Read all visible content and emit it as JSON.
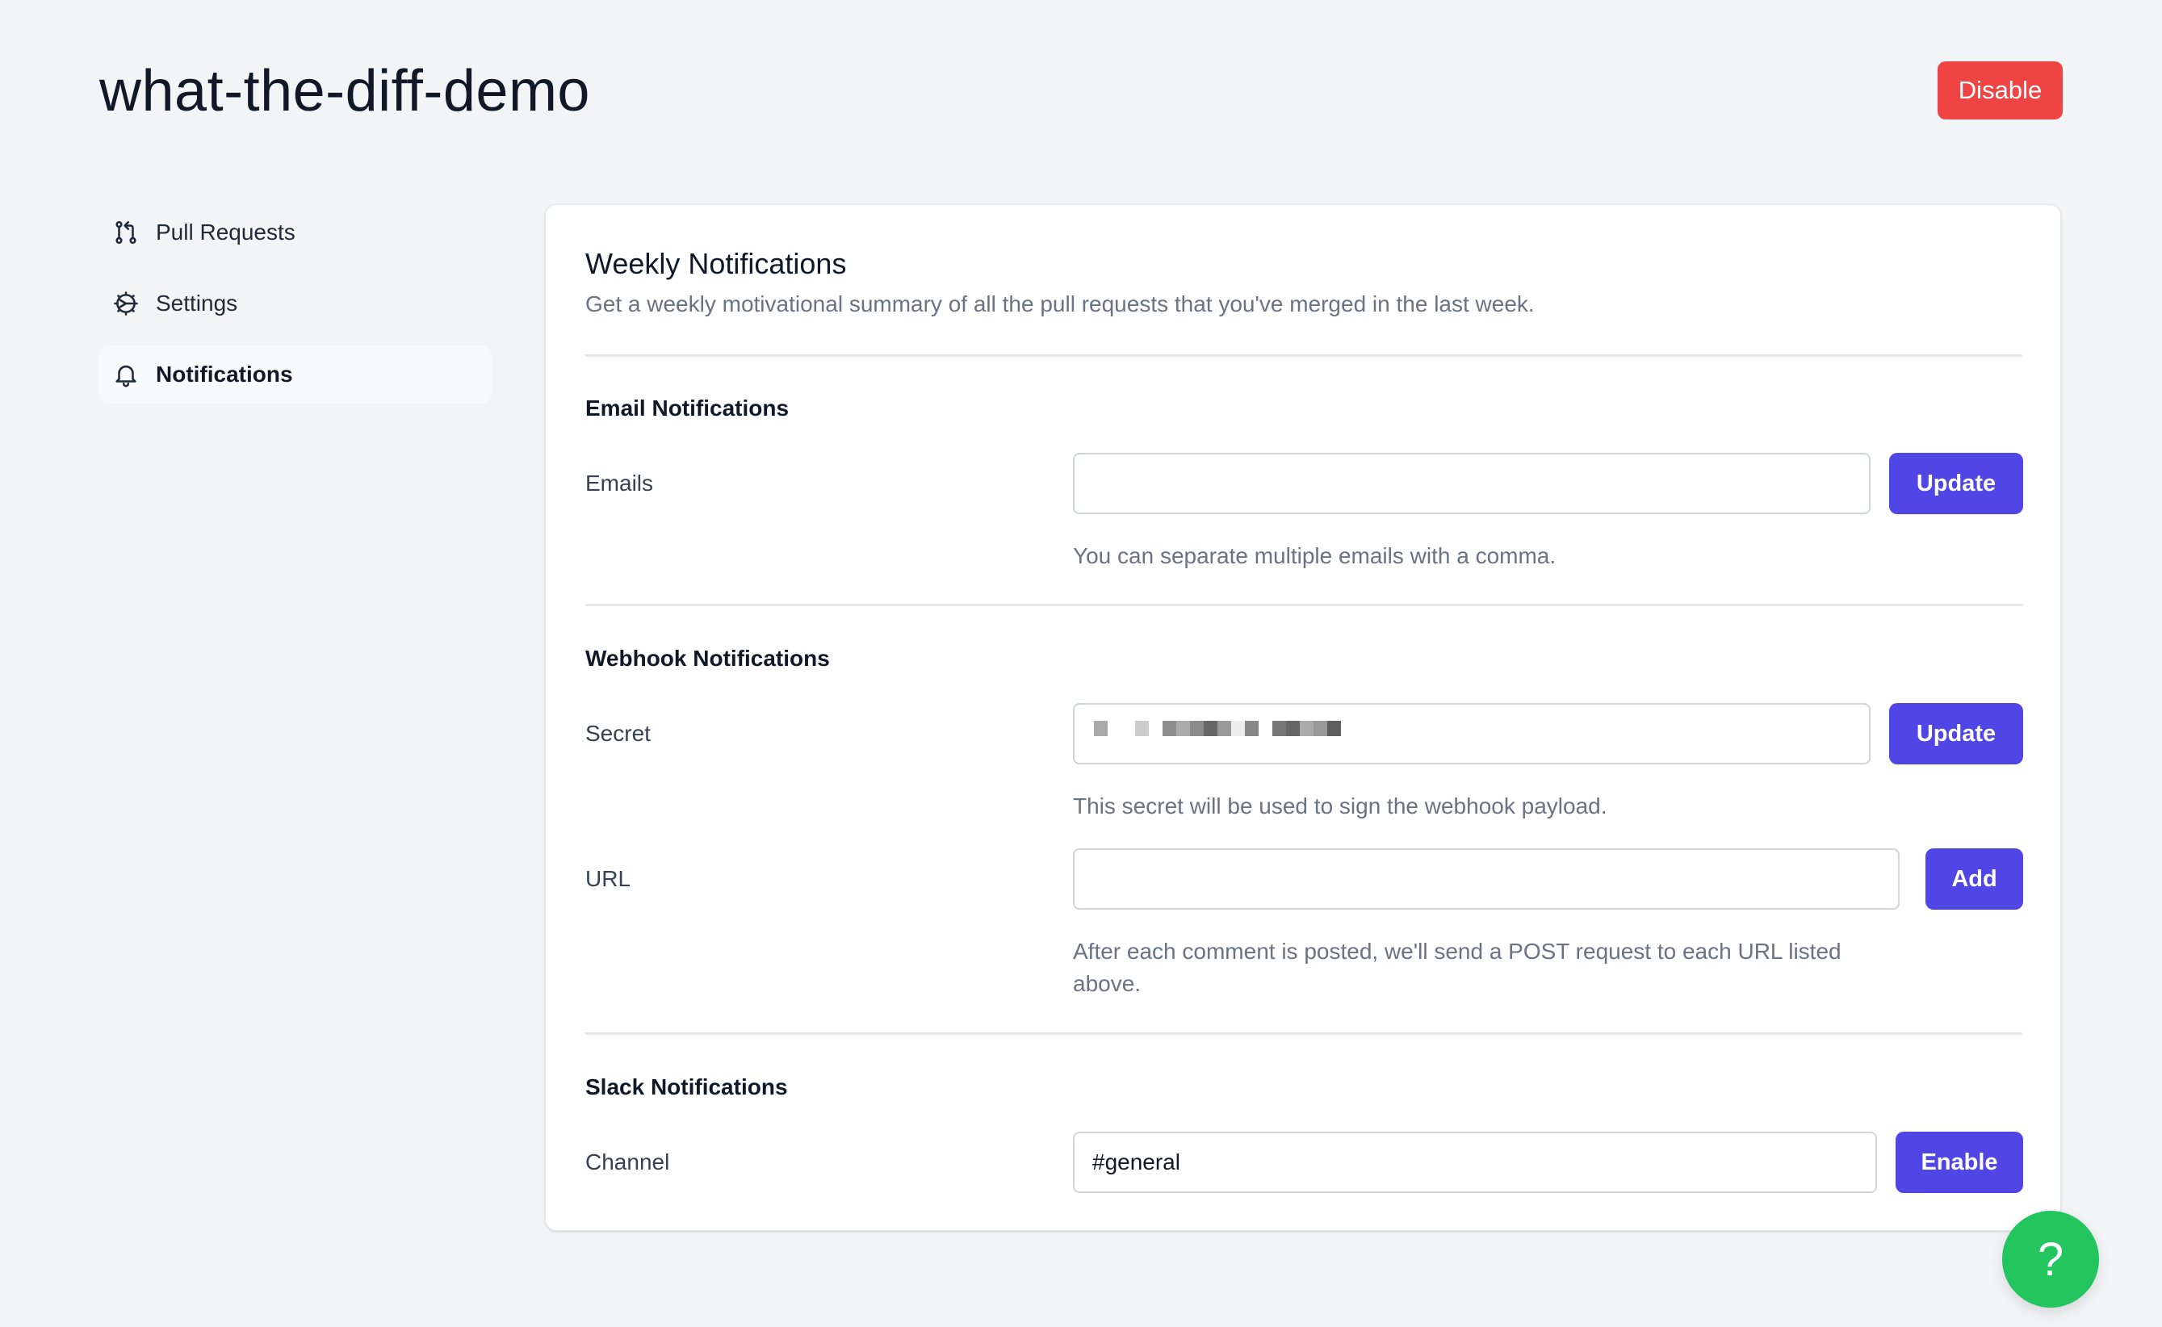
{
  "header": {
    "title": "what-the-diff-demo",
    "disable_label": "Disable",
    "disable_color": "#ef4444"
  },
  "sidebar": {
    "items": [
      {
        "label": "Pull Requests",
        "icon": "pull-request-icon",
        "active": false
      },
      {
        "label": "Settings",
        "icon": "gear-icon",
        "active": false
      },
      {
        "label": "Notifications",
        "icon": "bell-icon",
        "active": true
      }
    ]
  },
  "card": {
    "title": "Weekly Notifications",
    "description": "Get a weekly motivational summary of all the pull requests that you've merged in the last week.",
    "email": {
      "section_title": "Email Notifications",
      "label": "Emails",
      "value": "",
      "button": "Update",
      "help": "You can separate multiple emails with a comma."
    },
    "webhook": {
      "section_title": "Webhook Notifications",
      "secret_label": "Secret",
      "secret_value": "(redacted/pixelated)",
      "secret_button": "Update",
      "secret_help": "This secret will be used to sign the webhook payload.",
      "url_label": "URL",
      "url_value": "",
      "url_button": "Add",
      "url_help": "After each comment is posted, we'll send a POST request to each URL listed above."
    },
    "slack": {
      "section_title": "Slack Notifications",
      "channel_label": "Channel",
      "channel_value": "#general",
      "button": "Enable"
    }
  },
  "help_fab": {
    "label": "?",
    "color": "#22c55e"
  },
  "colors": {
    "primary": "#4f46e5",
    "background": "#f3f4f6"
  }
}
